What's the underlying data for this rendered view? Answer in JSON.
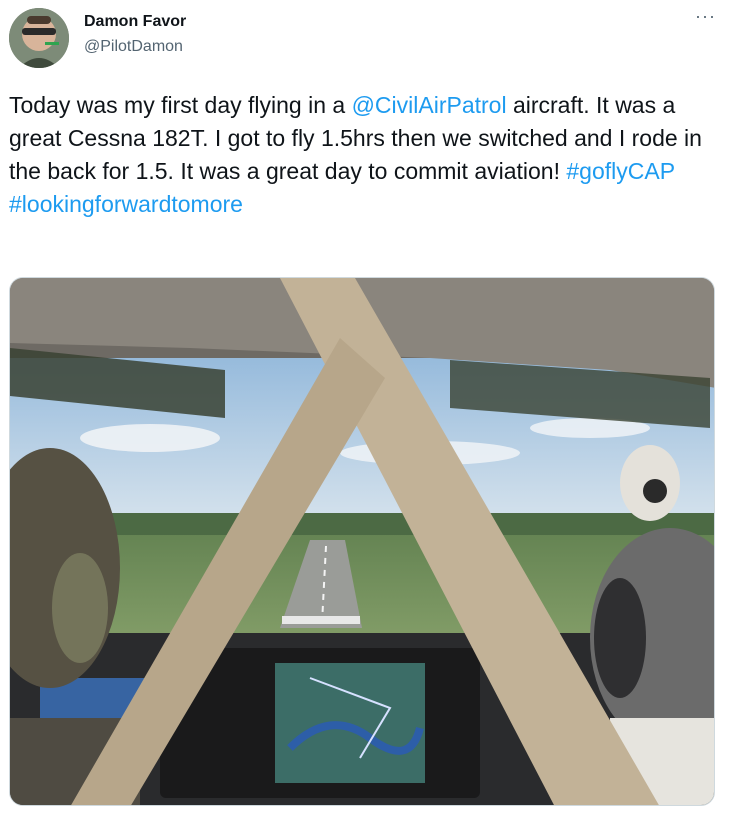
{
  "author": {
    "name": "Damon Favor",
    "handle": "@PilotDamon"
  },
  "more_icon": "more-horizontal-icon",
  "tweet": {
    "text_1": "Today was my first day flying in a ",
    "mention": "@CivilAirPatrol",
    "text_2": " aircraft. It was a great Cessna 182T. I got to fly 1.5hrs then we switched and I rode in the back for 1.5. It was a great day to commit aviation! ",
    "hashtag_1": "#goflyCAP",
    "hashtag_2": "#lookingforwardtomore"
  },
  "colors": {
    "link": "#1d9bf0",
    "text": "#0f1419",
    "secondary": "#536471"
  }
}
